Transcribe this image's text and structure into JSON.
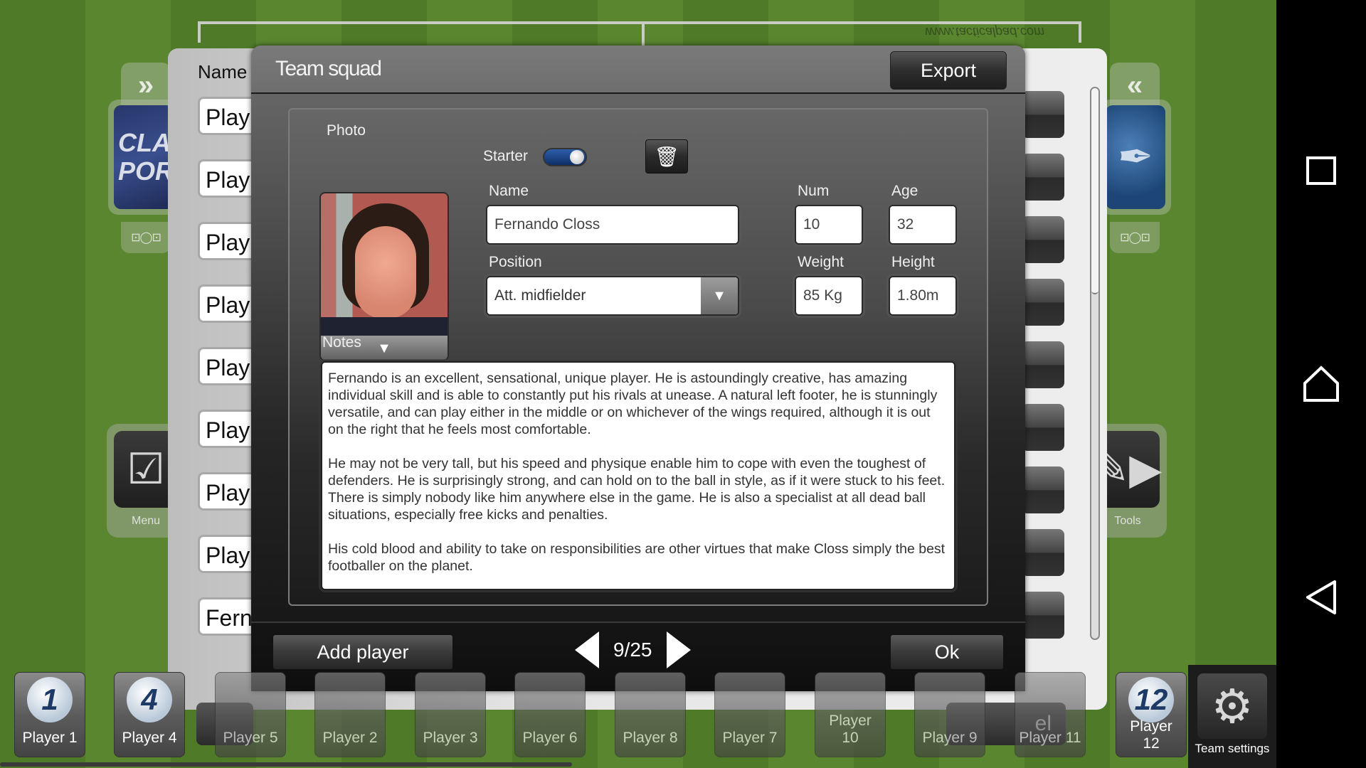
{
  "app": {
    "watermark": "www.tacticalpad.com"
  },
  "left_dock": {
    "collapse_icon": "double-chevron-right",
    "team_logo_text": [
      "CLAN",
      "PORT"
    ],
    "formation_icon": "formation-icon",
    "menu_label": "Menu"
  },
  "right_dock": {
    "collapse_icon": "double-chevron-left",
    "formation_icon": "formation-icon",
    "tools_label": "Tools"
  },
  "list_panel": {
    "header": "Name",
    "rows": [
      "Play",
      "Play",
      "Play",
      "Play",
      "Play",
      "Play",
      "Play",
      "Play",
      "Fern"
    ],
    "bottom_right_label": "el"
  },
  "dialog": {
    "title": "Team squad",
    "export_label": "Export",
    "photo_label": "Photo",
    "starter_label": "Starter",
    "starter_on": true,
    "name_label": "Name",
    "name_value": "Fernando Closs",
    "num_label": "Num",
    "num_value": "10",
    "age_label": "Age",
    "age_value": "32",
    "position_label": "Position",
    "position_value": "Att. midfielder",
    "weight_label": "Weight",
    "weight_value": "85 Kg",
    "height_label": "Height",
    "height_value": "1.80m",
    "notes_label": "Notes",
    "notes_value": "Fernando is an excellent, sensational, unique player. He is astoundingly creative, has amazing individual skill and is able to constantly put his rivals at unease. A natural left footer, he is stunningly versatile, and can play either in the middle or on whichever of the wings required, although it is out on the right that he feels most comfortable.\n\nHe may not be very tall, but his speed and physique enable him to cope with even the toughest of defenders. He is surprisingly strong, and can hold on to the ball in style, as if it were stuck to his feet. There is simply nobody like him anywhere else in the game. He is also a specialist at all dead ball situations, especially free kicks and penalties.\n\nHis cold blood and ability to take on responsibilities are other virtues that make Closs simply the best footballer on the planet.",
    "add_player_label": "Add player",
    "pager": "9/25",
    "ok_label": "Ok"
  },
  "player_bar": {
    "players": [
      {
        "label": "Player 1",
        "number": "1",
        "active": true
      },
      {
        "label": "Player 4",
        "number": "4",
        "active": true
      },
      {
        "label": "Player 5",
        "number": "",
        "active": false
      },
      {
        "label": "Player 2",
        "number": "",
        "active": false
      },
      {
        "label": "Player 3",
        "number": "",
        "active": false
      },
      {
        "label": "Player 6",
        "number": "",
        "active": false
      },
      {
        "label": "Player 8",
        "number": "",
        "active": false
      },
      {
        "label": "Player 7",
        "number": "",
        "active": false
      },
      {
        "label": "Player 10",
        "number": "",
        "active": false
      },
      {
        "label": "Player 9",
        "number": "",
        "active": false
      },
      {
        "label": "Player 11",
        "number": "",
        "active": false
      },
      {
        "label": "Player 12",
        "number": "12",
        "active": true
      }
    ],
    "team_settings_label": "Team settings"
  },
  "android_nav": {
    "recents": "recents-square",
    "home": "home",
    "back": "back"
  }
}
